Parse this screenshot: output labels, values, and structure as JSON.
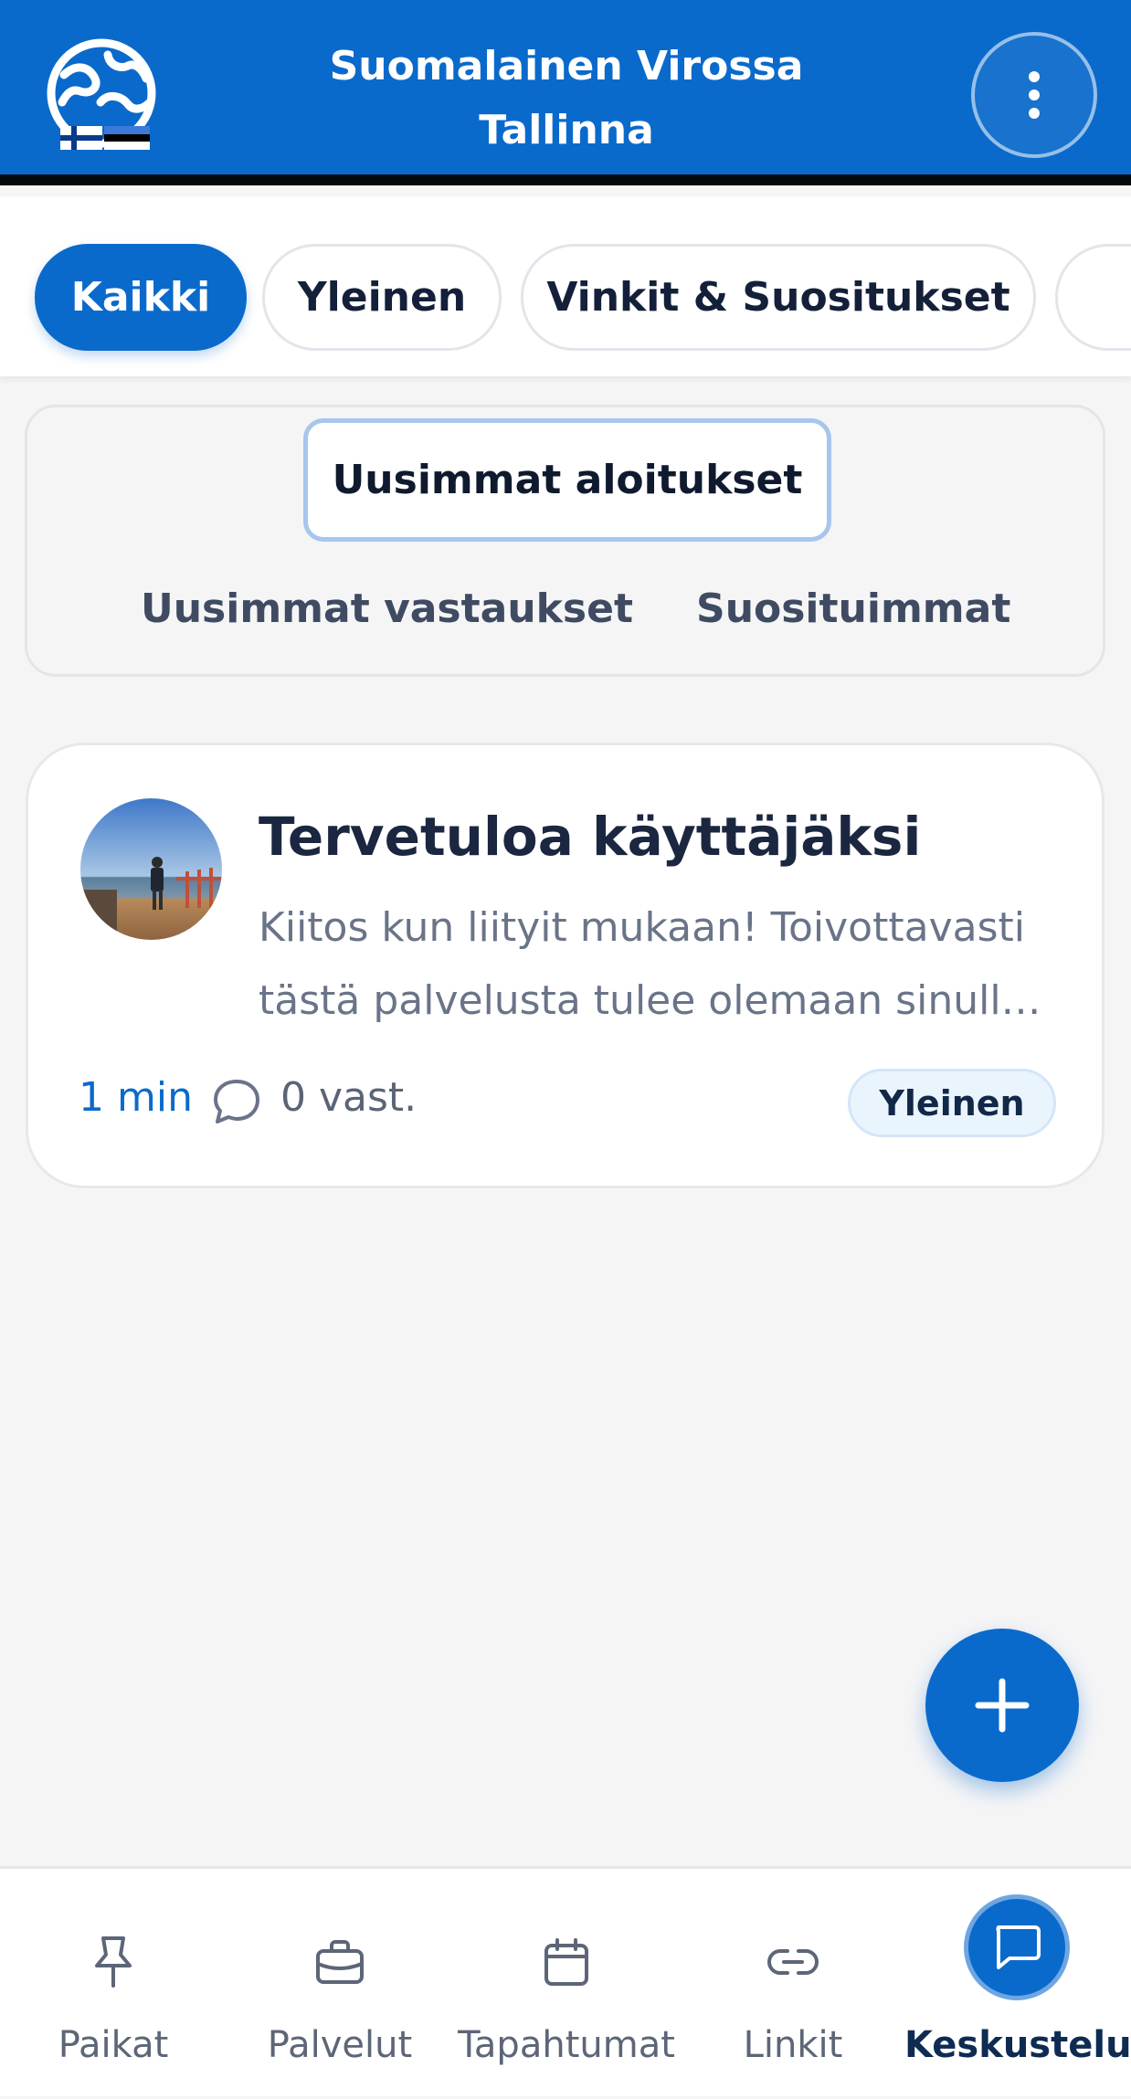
{
  "header": {
    "title_line1": "Suomalainen Virossa",
    "title_line2": "Tallinna",
    "logo_icon": "globe-flags-logo",
    "menu_icon": "more-vertical-icon",
    "colors": {
      "primary": "#0a6acb",
      "header_border": "#05090f"
    }
  },
  "categories": {
    "items": [
      {
        "label": "Kaikki",
        "active": true
      },
      {
        "label": "Yleinen",
        "active": false
      },
      {
        "label": "Vinkit & Suositukset",
        "active": false
      }
    ]
  },
  "sort": {
    "active": "Uusimmat aloitukset",
    "options": [
      "Uusimmat vastaukset",
      "Suosituimmat"
    ]
  },
  "posts": [
    {
      "title": "Tervetuloa käyttäjäksi",
      "body": "Kiitos kun liityit mukaan! Toivottavasti tästä palvelusta tulee olemaan sinulle hyötyä.",
      "time": "1 min",
      "replies": "0 vast.",
      "tag": "Yleinen",
      "avatar_icon": "user-avatar-photo"
    }
  ],
  "fab": {
    "icon": "plus-icon"
  },
  "bottom_nav": {
    "items": [
      {
        "label": "Paikat",
        "icon": "pin-icon",
        "active": false
      },
      {
        "label": "Palvelut",
        "icon": "briefcase-icon",
        "active": false
      },
      {
        "label": "Tapahtumat",
        "icon": "calendar-icon",
        "active": false
      },
      {
        "label": "Linkit",
        "icon": "link-icon",
        "active": false
      },
      {
        "label": "Keskustelut",
        "icon": "chat-icon",
        "active": true
      }
    ]
  }
}
